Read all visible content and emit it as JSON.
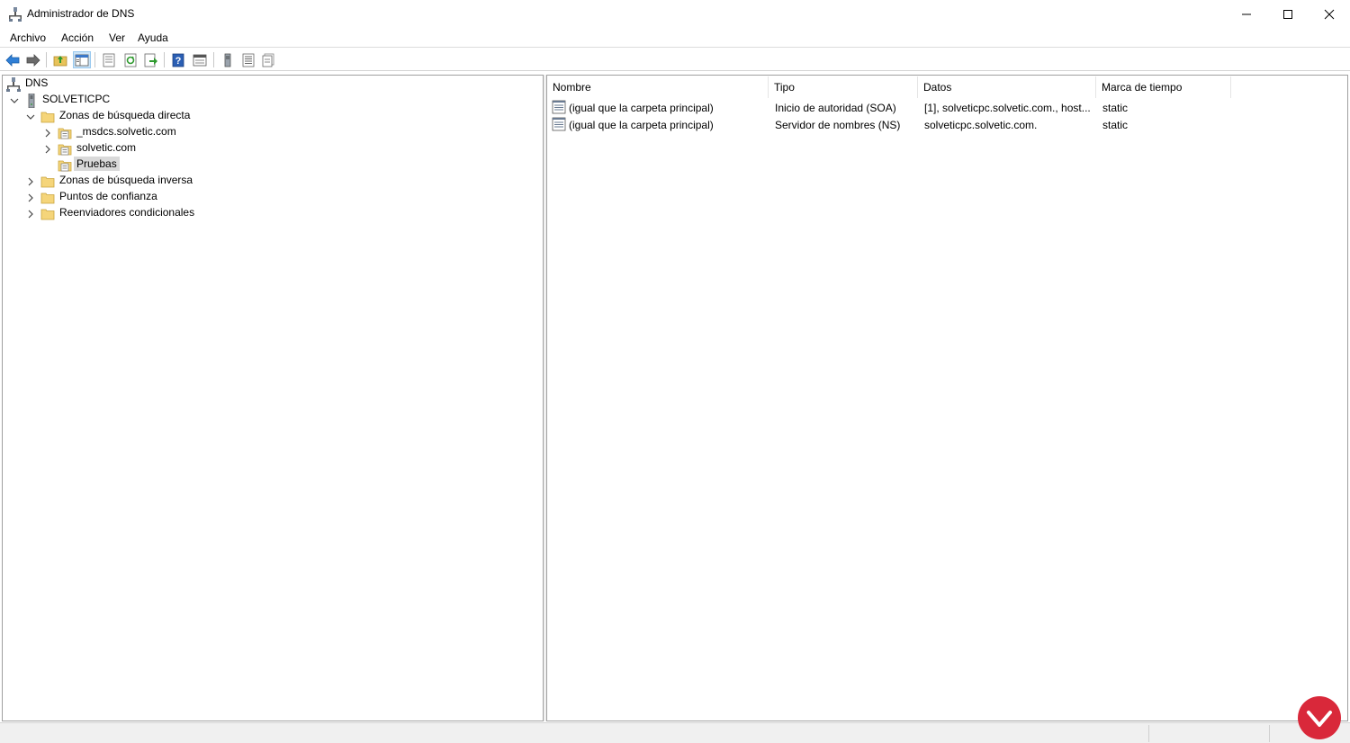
{
  "window": {
    "title": "Administrador de DNS",
    "icon": "dns-manager-icon"
  },
  "menu": [
    "Archivo",
    "Acción",
    "Ver",
    "Ayuda"
  ],
  "toolbar": {
    "buttons": [
      {
        "name": "back-icon"
      },
      {
        "name": "forward-icon"
      },
      {
        "name": "up-folder-icon"
      },
      {
        "name": "show-hide-tree-icon",
        "active": true
      },
      {
        "name": "properties-icon"
      },
      {
        "name": "refresh-icon"
      },
      {
        "name": "export-list-icon"
      },
      {
        "name": "help-icon"
      },
      {
        "name": "view-icon"
      },
      {
        "name": "server-icon"
      },
      {
        "name": "list-icon"
      },
      {
        "name": "records-icon"
      }
    ]
  },
  "tree": [
    {
      "label": "DNS",
      "level": 0,
      "icon": "dns-icon",
      "expander": "none"
    },
    {
      "label": "SOLVETICPC",
      "level": 0,
      "icon": "server-icon",
      "expander": "expanded"
    },
    {
      "label": "Zonas de búsqueda directa",
      "level": 1,
      "icon": "folder-icon",
      "expander": "expanded"
    },
    {
      "label": "_msdcs.solvetic.com",
      "level": 2,
      "icon": "zone-icon",
      "expander": "collapsed"
    },
    {
      "label": "solvetic.com",
      "level": 2,
      "icon": "zone-icon",
      "expander": "collapsed"
    },
    {
      "label": "Pruebas",
      "level": 2,
      "icon": "zone-icon",
      "expander": "none",
      "selected": true
    },
    {
      "label": "Zonas de búsqueda inversa",
      "level": 1,
      "icon": "folder-icon",
      "expander": "collapsed"
    },
    {
      "label": "Puntos de confianza",
      "level": 1,
      "icon": "folder-icon",
      "expander": "collapsed"
    },
    {
      "label": "Reenviadores condicionales",
      "level": 1,
      "icon": "folder-icon",
      "expander": "collapsed"
    }
  ],
  "list": {
    "columns": [
      "Nombre",
      "Tipo",
      "Datos",
      "Marca de tiempo"
    ],
    "rows": [
      {
        "nombre": "(igual que la carpeta principal)",
        "tipo": "Inicio de autoridad (SOA)",
        "datos": "[1], solveticpc.solvetic.com., host...",
        "marca": "static"
      },
      {
        "nombre": "(igual que la carpeta principal)",
        "tipo": "Servidor de nombres (NS)",
        "datos": "solveticpc.solvetic.com.",
        "marca": "static"
      }
    ]
  },
  "colors": {
    "selection": "#d9d9d9",
    "toolbar_active": "#cce4f7",
    "logo": "#d9283a"
  }
}
